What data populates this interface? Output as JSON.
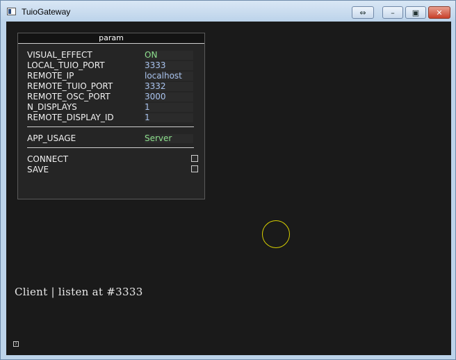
{
  "window": {
    "title": "TuioGateway"
  },
  "titlebar_buttons": [
    {
      "name": "resize-arrows",
      "glyph": "⇔"
    },
    {
      "name": "minimize",
      "glyph": "–"
    },
    {
      "name": "maximize",
      "glyph": "▣"
    },
    {
      "name": "close",
      "glyph": "✕"
    }
  ],
  "panel": {
    "title": "param",
    "params": [
      {
        "key": "VISUAL_EFFECT",
        "value": "ON",
        "color": "green"
      },
      {
        "key": "LOCAL_TUIO_PORT",
        "value": "3333",
        "color": "blue"
      },
      {
        "key": "REMOTE_IP",
        "value": "localhost",
        "color": "blue"
      },
      {
        "key": "REMOTE_TUIO_PORT",
        "value": "3332",
        "color": "blue"
      },
      {
        "key": "REMOTE_OSC_PORT",
        "value": "3000",
        "color": "blue"
      },
      {
        "key": "N_DISPLAYS",
        "value": "1",
        "color": "blue"
      },
      {
        "key": "REMOTE_DISPLAY_ID",
        "value": "1",
        "color": "blue"
      }
    ],
    "app_usage": {
      "key": "APP_USAGE",
      "value": "Server"
    },
    "toggles": [
      {
        "key": "CONNECT",
        "checked": false
      },
      {
        "key": "SAVE",
        "checked": false
      }
    ]
  },
  "status_text": "Client | listen at #3333",
  "help_glyph": "?",
  "colors": {
    "value_green": "#8ee08e",
    "value_blue": "#a9c3ee",
    "cursor_circle": "#d8d000",
    "canvas": "#1a1a1a"
  }
}
